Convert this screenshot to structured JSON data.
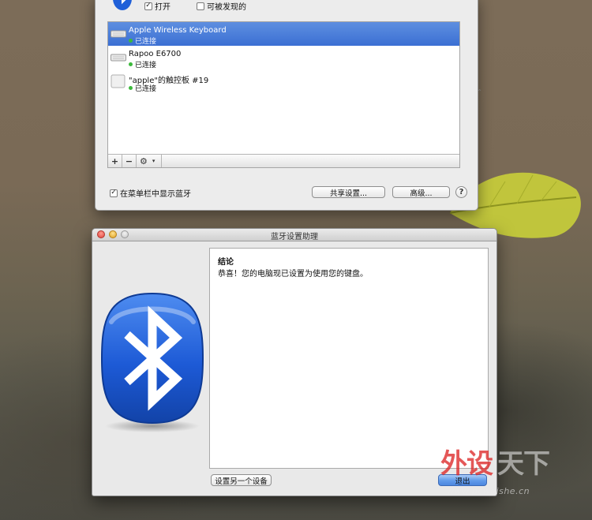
{
  "prefs": {
    "open_label": "打开",
    "open_checked": true,
    "discoverable_label": "可被发现的",
    "discoverable_checked": false,
    "devices": [
      {
        "name": "Apple Wireless Keyboard",
        "status": "已连接",
        "icon": "keyboard-icon",
        "selected": true
      },
      {
        "name": "Rapoo E6700",
        "status": "已连接",
        "icon": "keyboard-icon",
        "selected": false
      },
      {
        "name": "\"apple\"的触控板 #19",
        "status": "已连接",
        "icon": "trackpad-icon",
        "selected": false
      }
    ],
    "toolbar": {
      "add": "+",
      "remove": "−",
      "gear_arrow": "▾"
    },
    "menu_bar_label": "在菜单栏中显示蓝牙",
    "menu_bar_checked": true,
    "share_button": "共享设置...",
    "advanced_button": "高级...",
    "help_label": "?"
  },
  "assistant": {
    "title": "蓝牙设置助理",
    "heading": "结论",
    "message": "恭喜！您的电脑现已设置为使用您的键盘。",
    "setup_another_button": "设置另一个设备",
    "quit_button": "退出"
  },
  "watermark": {
    "text_left": "外设",
    "text_right": "天下",
    "url": "www.pcwaishe.cn"
  },
  "colors": {
    "selection": "#3b6fd3",
    "bluetooth_blue": "#1f5fd8",
    "status_green": "#3cb93c"
  }
}
